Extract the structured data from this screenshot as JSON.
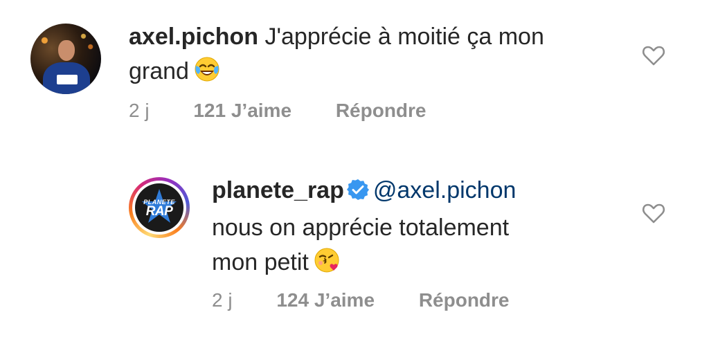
{
  "comments": [
    {
      "username": "axel.pichon",
      "text_line1": "J'apprécie à moitié ça mon",
      "text_line2": "grand",
      "emoji": "face-with-tears-of-joy",
      "time": "2 j",
      "likes": "121 J’aime",
      "reply": "Répondre",
      "like_icon": "heart-outline-icon"
    },
    {
      "username": "planete_rap",
      "verified": true,
      "mention": "@axel.pichon",
      "text_line1": "nous on apprécie totalement",
      "text_line2": "mon petit",
      "emoji": "face-blowing-a-kiss",
      "avatar_text_small": "PLANETE",
      "avatar_text_big": "RAP",
      "time": "2 j",
      "likes": "124 J’aime",
      "reply": "Répondre",
      "like_icon": "heart-outline-icon"
    }
  ],
  "colors": {
    "text": "#262626",
    "muted": "#8e8e8e",
    "mention": "#00376b",
    "verified": "#3897f0"
  }
}
